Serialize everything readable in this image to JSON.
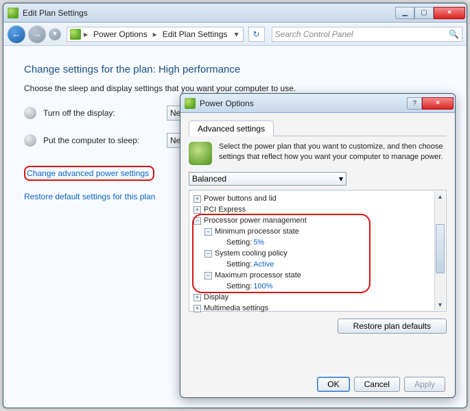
{
  "window": {
    "title": "Edit Plan Settings",
    "min_glyph": "▁",
    "max_glyph": "▢",
    "close_glyph": "×"
  },
  "nav": {
    "back_glyph": "←",
    "fwd_glyph": "→",
    "down_glyph": "▾",
    "crumb1": "Power Options",
    "crumb2": "Edit Plan Settings",
    "arrow": "▸",
    "refresh_glyph": "↻",
    "search_placeholder": "Search Control Panel",
    "search_glyph": "🔍"
  },
  "main": {
    "heading": "Change settings for the plan: High performance",
    "subtext": "Choose the sleep and display settings that you want your computer to use.",
    "row1_label": "Turn off the display:",
    "row1_value": "Nev",
    "row2_label": "Put the computer to sleep:",
    "row2_value": "Nev",
    "link_advanced": "Change advanced power settings",
    "link_restore": "Restore default settings for this plan"
  },
  "dialog": {
    "title": "Power Options",
    "help_glyph": "?",
    "close_glyph": "×",
    "tab": "Advanced settings",
    "intro": "Select the power plan that you want to customize, and then choose settings that reflect how you want your computer to manage power.",
    "plan_selected": "Balanced",
    "plan_arrow": "▾",
    "tree": {
      "n0": {
        "pm": "+",
        "label": "Power buttons and lid"
      },
      "n1": {
        "pm": "+",
        "label": "PCI Express"
      },
      "n2": {
        "pm": "−",
        "label": "Processor power management"
      },
      "n3": {
        "pm": "−",
        "label": "Minimum processor state"
      },
      "n4_label": "Setting:",
      "n4_value": "5%",
      "n5": {
        "pm": "−",
        "label": "System cooling policy"
      },
      "n6_label": "Setting:",
      "n6_value": "Active",
      "n7": {
        "pm": "−",
        "label": "Maximum processor state"
      },
      "n8_label": "Setting:",
      "n8_value": "100%",
      "n9": {
        "pm": "+",
        "label": "Display"
      },
      "n10": {
        "pm": "+",
        "label": "Multimedia settings"
      }
    },
    "restore_btn": "Restore plan defaults",
    "ok": "OK",
    "cancel": "Cancel",
    "apply": "Apply"
  }
}
